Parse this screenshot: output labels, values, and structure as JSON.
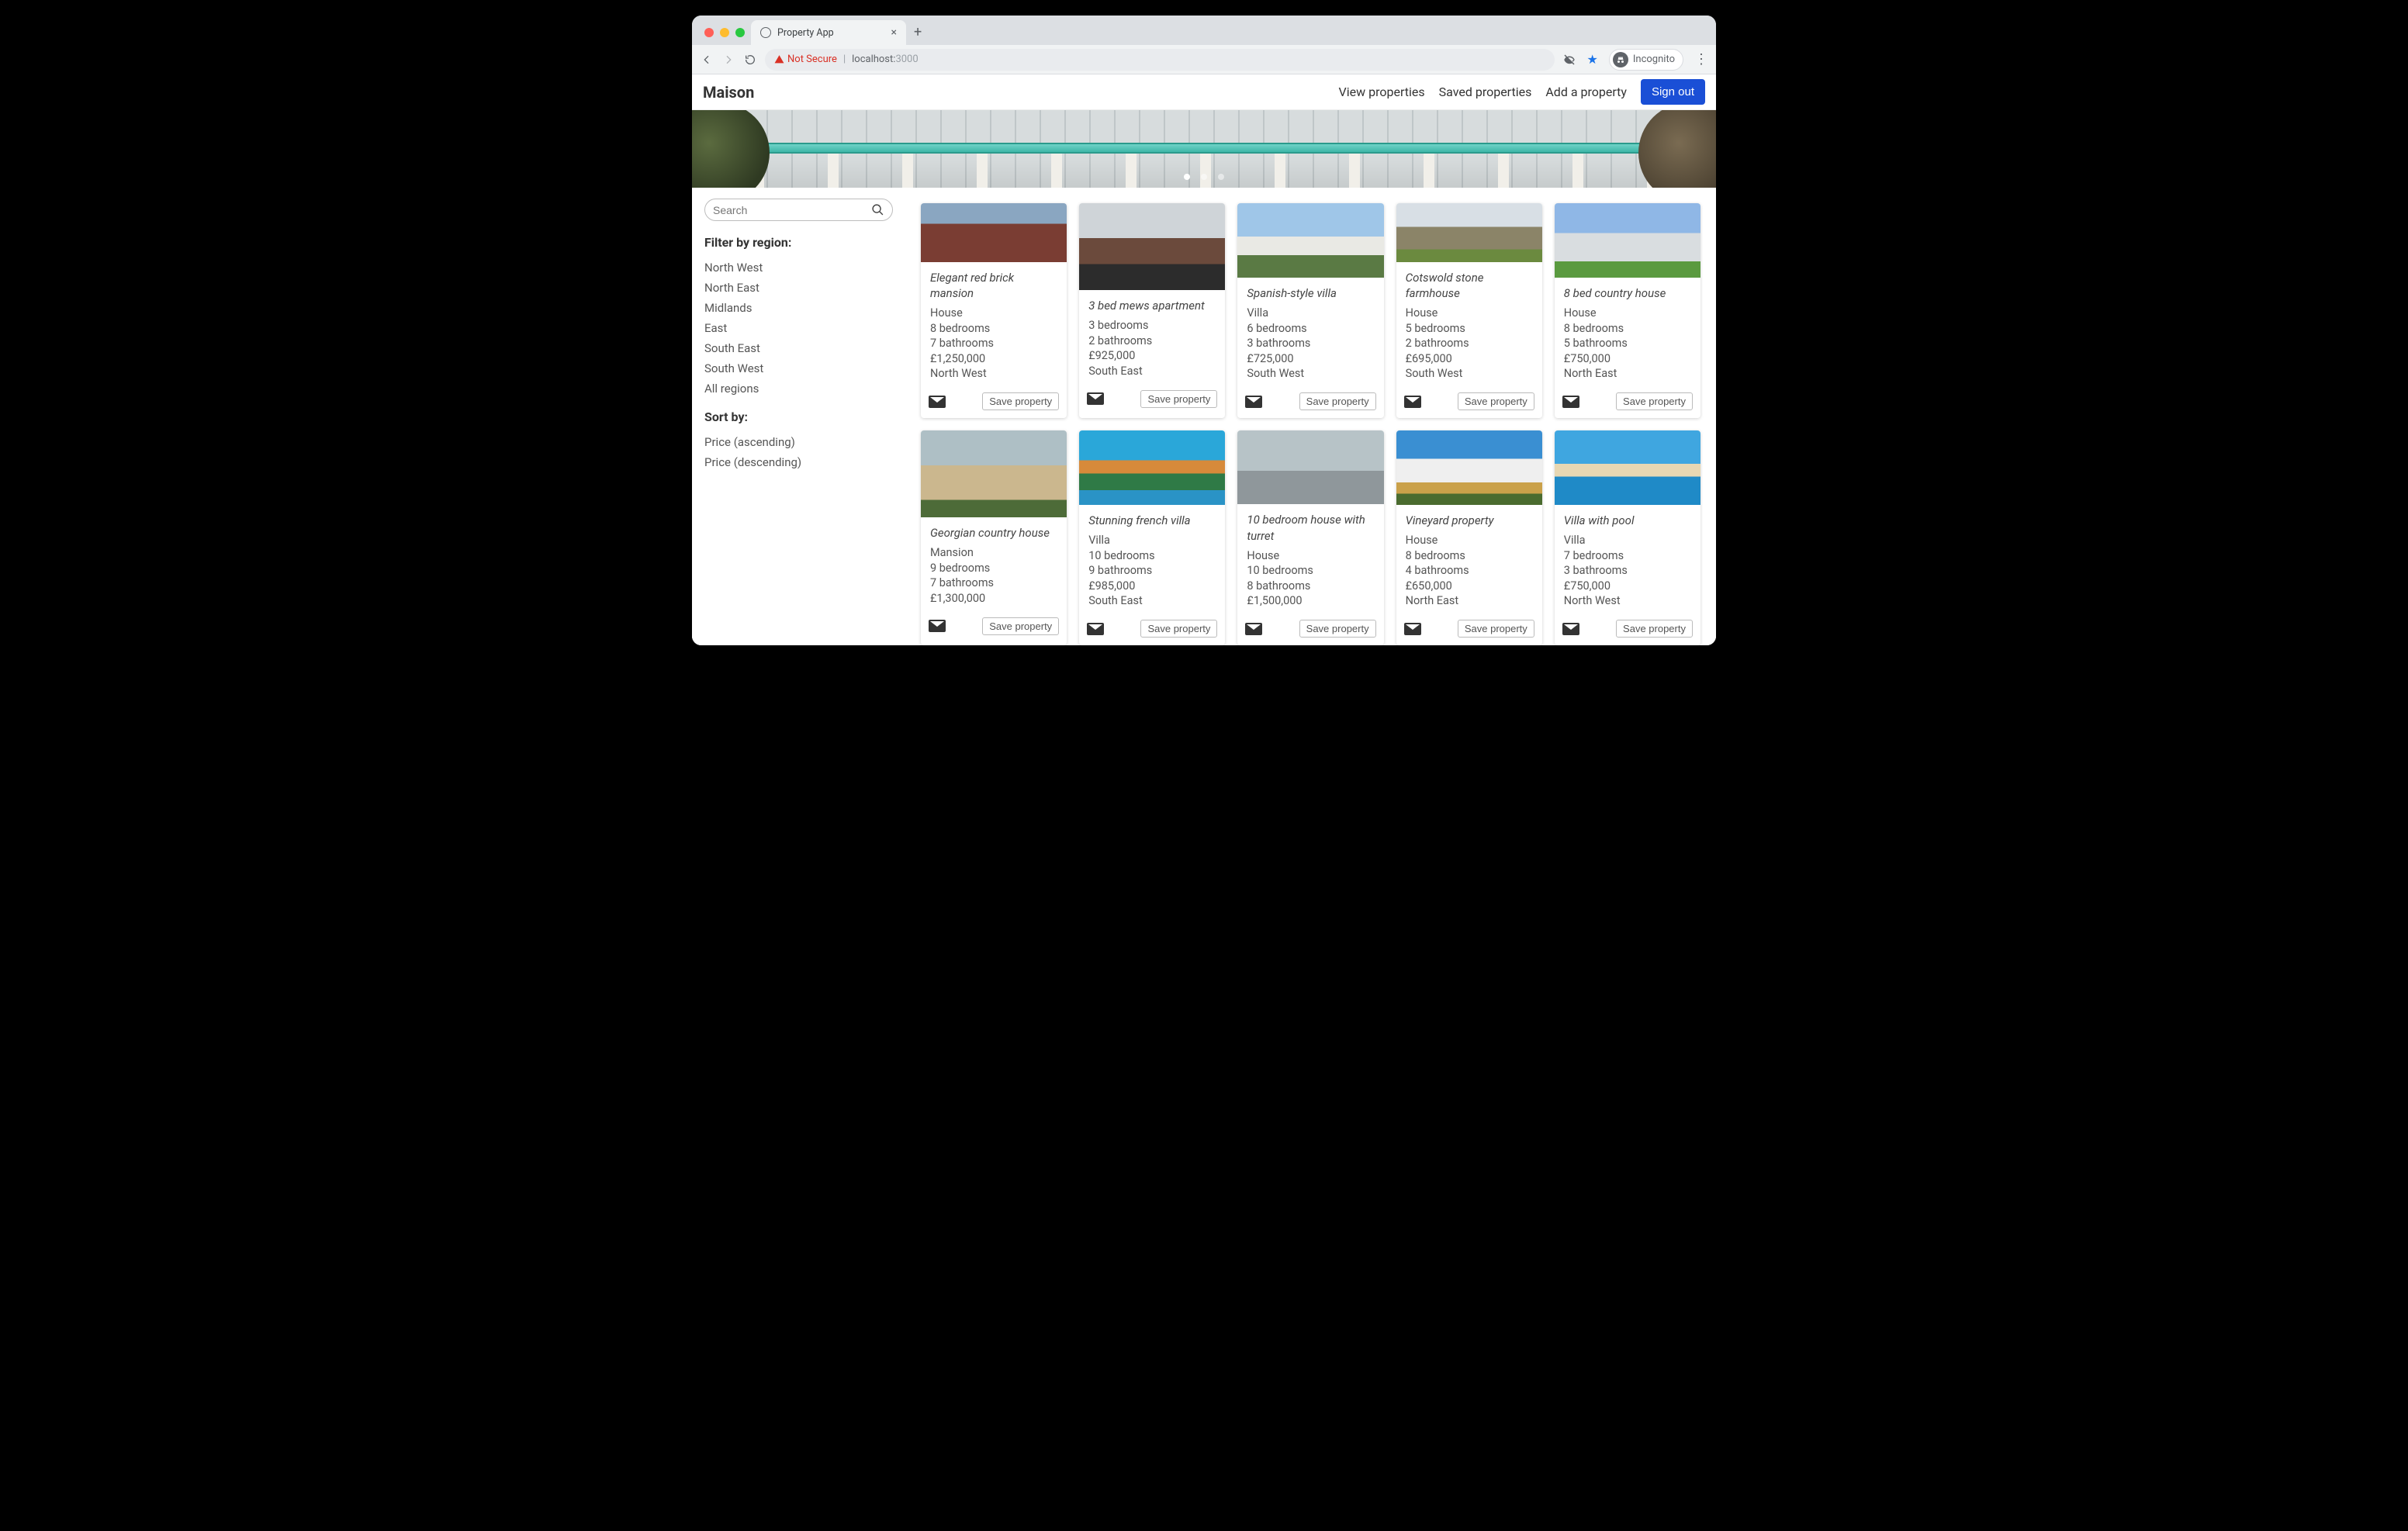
{
  "browser": {
    "tab_title": "Property App",
    "not_secure": "Not Secure",
    "url_host": "localhost:",
    "url_port": "3000",
    "incognito": "Incognito"
  },
  "app": {
    "brand": "Maison",
    "nav": {
      "view": "View properties",
      "saved": "Saved properties",
      "add": "Add a property",
      "signout": "Sign out"
    }
  },
  "sidebar": {
    "search_placeholder": "Search",
    "filter_heading": "Filter by region:",
    "regions": [
      "North West",
      "North East",
      "Midlands",
      "East",
      "South East",
      "South West",
      "All regions"
    ],
    "sort_heading": "Sort by:",
    "sorts": [
      "Price (ascending)",
      "Price (descending)"
    ]
  },
  "labels": {
    "save": "Save property",
    "bedrooms_suffix": " bedrooms",
    "bathrooms_suffix": " bathrooms"
  },
  "properties": [
    {
      "title": "Elegant red brick mansion",
      "type": "House",
      "bedrooms": 8,
      "bathrooms": 7,
      "price": "£1,250,000",
      "region": "North West"
    },
    {
      "title": "3 bed mews apartment",
      "type": null,
      "bedrooms": 3,
      "bathrooms": 2,
      "price": "£925,000",
      "region": "South East"
    },
    {
      "title": "Spanish-style villa",
      "type": "Villa",
      "bedrooms": 6,
      "bathrooms": 3,
      "price": "£725,000",
      "region": "South West"
    },
    {
      "title": "Cotswold stone farmhouse",
      "type": "House",
      "bedrooms": 5,
      "bathrooms": 2,
      "price": "£695,000",
      "region": "South West"
    },
    {
      "title": "8 bed country house",
      "type": "House",
      "bedrooms": 8,
      "bathrooms": 5,
      "price": "£750,000",
      "region": "North East"
    },
    {
      "title": "Georgian country house",
      "type": "Mansion",
      "bedrooms": 9,
      "bathrooms": 7,
      "price": "£1,300,000",
      "region": null
    },
    {
      "title": "Stunning french villa",
      "type": "Villa",
      "bedrooms": 10,
      "bathrooms": 9,
      "price": "£985,000",
      "region": "South East"
    },
    {
      "title": "10 bedroom house with turret",
      "type": "House",
      "bedrooms": 10,
      "bathrooms": 8,
      "price": "£1,500,000",
      "region": null
    },
    {
      "title": "Vineyard property",
      "type": "House",
      "bedrooms": 8,
      "bathrooms": 4,
      "price": "£650,000",
      "region": "North East"
    },
    {
      "title": "Villa with pool",
      "type": "Villa",
      "bedrooms": 7,
      "bathrooms": 3,
      "price": "£750,000",
      "region": "North West"
    }
  ]
}
